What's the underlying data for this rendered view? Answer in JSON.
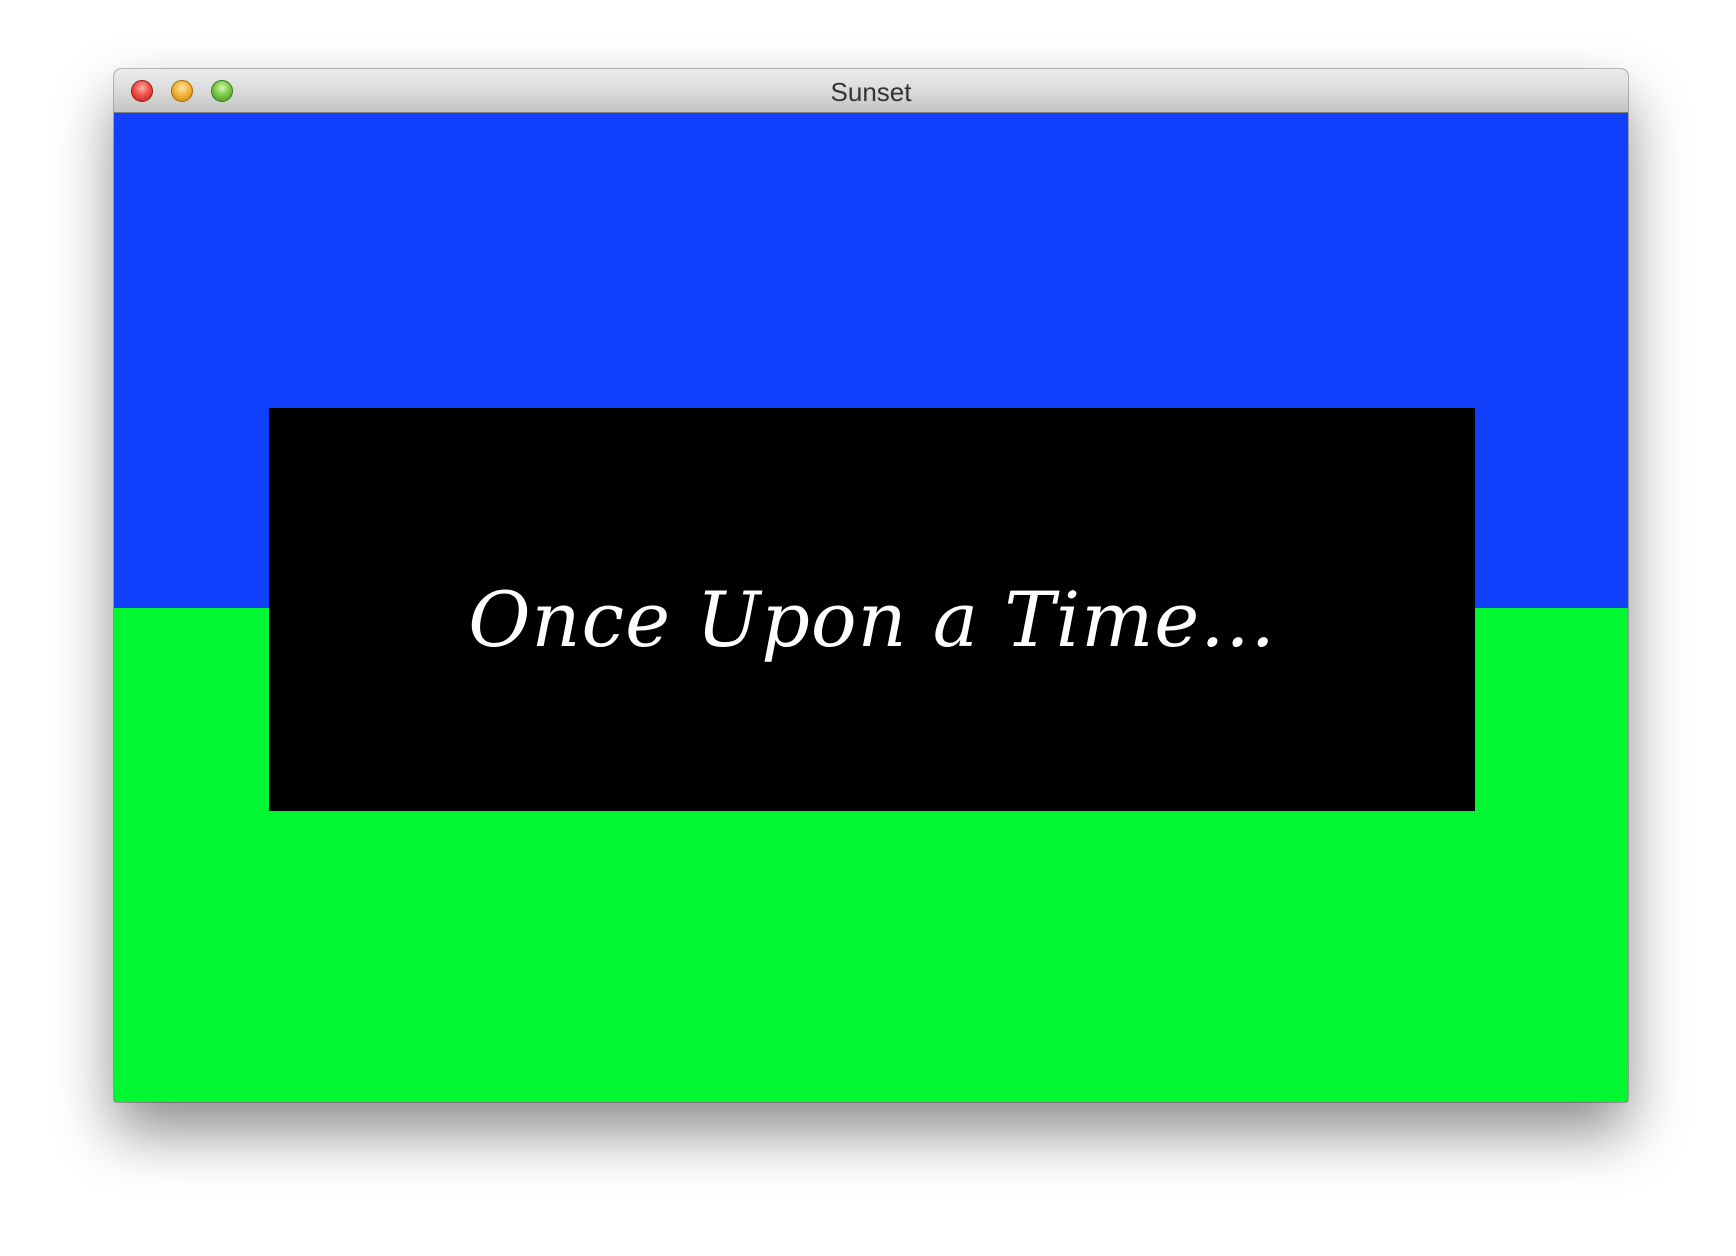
{
  "window": {
    "title": "Sunset",
    "controls": {
      "close": "close-button",
      "minimize": "minimize-button",
      "zoom": "zoom-button"
    }
  },
  "scene": {
    "caption": "Once Upon a Time...",
    "colors": {
      "sky": "#1040fb",
      "ground": "#00f732",
      "panel": "#000000",
      "caption_text": "#ffffff"
    }
  }
}
